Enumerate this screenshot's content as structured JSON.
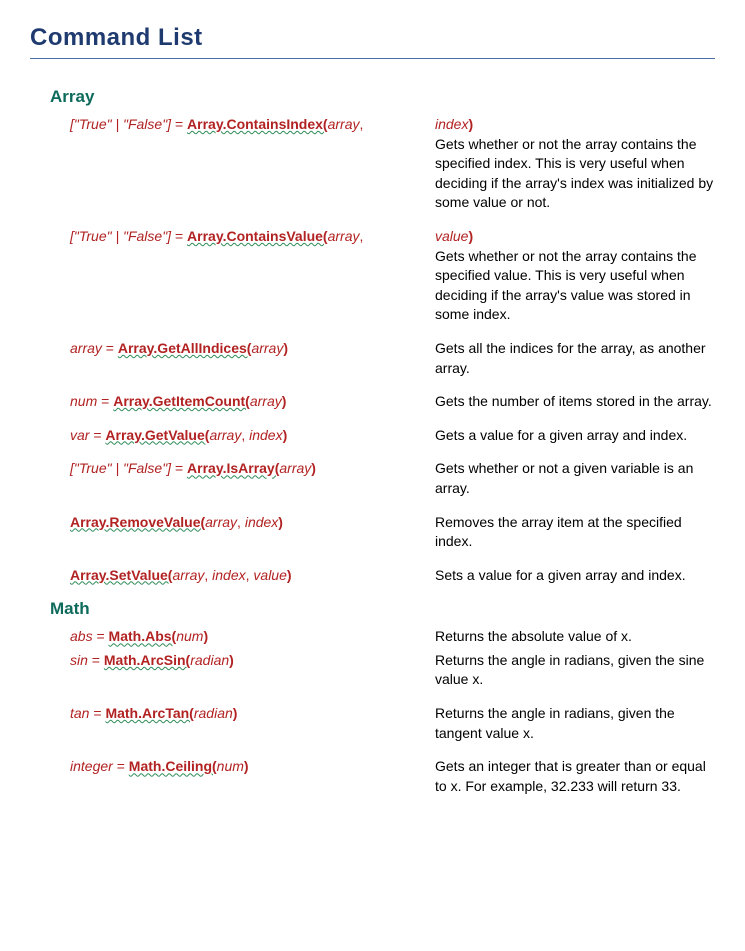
{
  "title": "Command List",
  "sections": [
    {
      "name": "Array",
      "entries": [
        {
          "ret": "[\"True\" | \"False\"]",
          "retKind": "lit",
          "fn": "Array.ContainsIndex(",
          "params": [
            "array",
            "index"
          ],
          "trailParamInDesc": true,
          "desc": "Gets whether or not the array contains the specified index. This is very useful when deciding if the array's index was initialized by some value or not."
        },
        {
          "ret": "[\"True\" | \"False\"]",
          "retKind": "lit",
          "fn": "Array.ContainsValue(",
          "params": [
            "array",
            "value"
          ],
          "trailParamInDesc": true,
          "desc": "Gets whether or not the array contains the specified value. This is very useful when deciding if the array's value was stored in some index."
        },
        {
          "ret": "array",
          "retKind": "type",
          "fn": "Array.GetAllIndices(",
          "params": [
            "array"
          ],
          "desc": "Gets all the indices for the array, as another array."
        },
        {
          "ret": "num",
          "retKind": "type",
          "fn": "Array.GetItemCount(",
          "params": [
            "array"
          ],
          "desc": "Gets the number of items stored in the array."
        },
        {
          "ret": "var",
          "retKind": "type",
          "fn": "Array.GetValue(",
          "params": [
            "array",
            "index"
          ],
          "desc": "Gets a value for a given array and index."
        },
        {
          "ret": "[\"True\" | \"False\"]",
          "retKind": "lit",
          "fn": "Array.IsArray(",
          "params": [
            "array"
          ],
          "desc": "Gets whether or not a given variable is an array."
        },
        {
          "ret": "",
          "retKind": "none",
          "fn": "Array.RemoveValue(",
          "params": [
            "array",
            "index"
          ],
          "desc": "Removes the array item at the specified index."
        },
        {
          "ret": "",
          "retKind": "none",
          "fn": "Array.SetValue(",
          "params": [
            "array",
            "index",
            "value"
          ],
          "desc": "Sets a value for a given array and index."
        }
      ]
    },
    {
      "name": "Math",
      "entries": [
        {
          "ret": "abs",
          "retKind": "type",
          "fn": "Math.Abs(",
          "params": [
            "num"
          ],
          "tight": true,
          "desc": "Returns the absolute value of x."
        },
        {
          "ret": "sin",
          "retKind": "type",
          "fn": "Math.ArcSin(",
          "params": [
            "radian"
          ],
          "desc": "Returns the angle in radians, given the sine value x."
        },
        {
          "ret": "tan",
          "retKind": "type",
          "fn": "Math.ArcTan(",
          "params": [
            "radian"
          ],
          "desc": "Returns the angle in radians, given the tangent value x."
        },
        {
          "ret": "integer",
          "retKind": "type",
          "fn": "Math.Ceiling(",
          "params": [
            "num"
          ],
          "desc": "Gets an integer that is greater than or equal to x. For example, 32.233 will return 33."
        }
      ]
    }
  ]
}
